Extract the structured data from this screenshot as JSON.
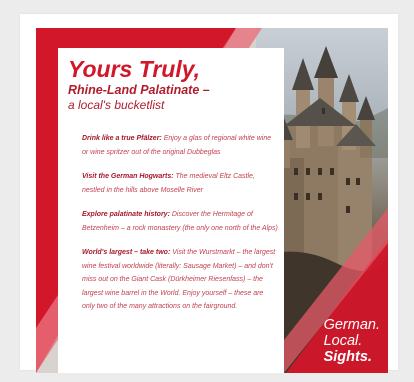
{
  "poster": {
    "title": "Yours Truly,",
    "subtitle": "Rhine-Land Palatinate –",
    "subtitle2": "a local's bucketlist",
    "items": [
      {
        "heading": "Drink like a true Pfälzer:",
        "text": "Enjoy a glas of regional white wine or wine spritzer out of the original Dubbeglas"
      },
      {
        "heading": "Visit the German Hogwarts:",
        "text": "The medieval Eltz Castle, nestled in the hills above Moselle River"
      },
      {
        "heading": "Explore palatinate history:",
        "text": "Discover the Hermitage of Betzenheim – a rock monastery (the only one north of the Alps)"
      },
      {
        "heading": "World's largest – take two:",
        "text": "Visit the Wurstmarkt – the largest wine festival worldwide (literally: Sausage Market) – and don't miss out on the Giant Cask (Dürkheimer Riesenfass) – the largest wine barrel in the World. Enjoy yourself – these are only two of the many attractions on the fairground."
      }
    ],
    "slogan": {
      "line1": "German.",
      "line2": "Local.",
      "line3": "Sights."
    }
  },
  "colors": {
    "brand_red": "#d2172a",
    "dark_red": "#a8182a",
    "background": "#ececec"
  }
}
